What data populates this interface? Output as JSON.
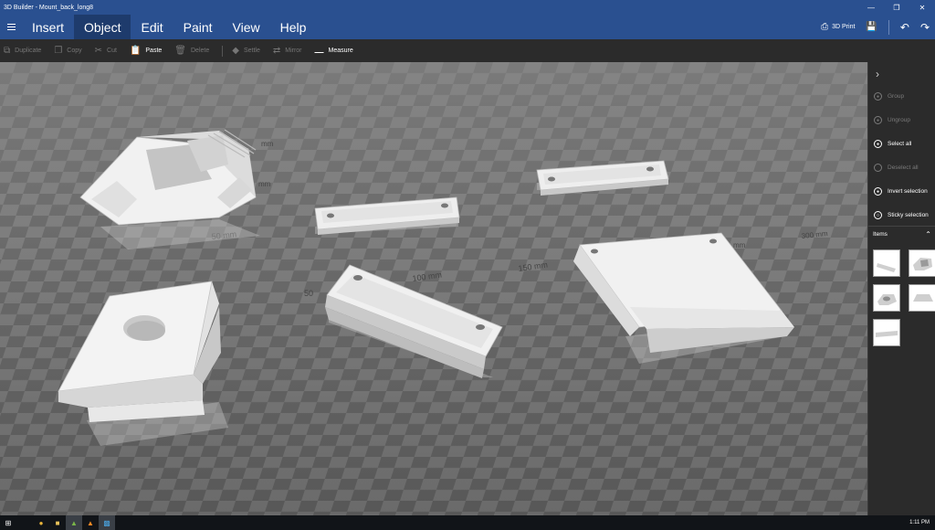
{
  "window": {
    "title": "3D Builder - Mount_back_long8"
  },
  "menu": {
    "items": [
      {
        "label": "Insert"
      },
      {
        "label": "Object"
      },
      {
        "label": "Edit"
      },
      {
        "label": "Paint"
      },
      {
        "label": "View"
      },
      {
        "label": "Help"
      }
    ],
    "active": "Object",
    "print_label": "3D Print"
  },
  "toolbar": {
    "duplicate": "Duplicate",
    "copy": "Copy",
    "cut": "Cut",
    "paste": "Paste",
    "delete": "Delete",
    "settle": "Settle",
    "mirror": "Mirror",
    "measure": "Measure"
  },
  "viewport": {
    "ruler_labels": [
      "50 mm",
      "100 mm",
      "150 mm",
      "50",
      "mm",
      "300 mm",
      "mm",
      "mm"
    ]
  },
  "sidepanel": {
    "group": "Group",
    "ungroup": "Ungroup",
    "select_all": "Select all",
    "deselect_all": "Deselect all",
    "invert_selection": "Invert selection",
    "sticky_selection": "Sticky selection",
    "items_label": "Items"
  },
  "taskbar": {
    "clock": "1:11 PM"
  },
  "colors": {
    "accent": "#2a5090",
    "panel": "#2b2b2b",
    "object": "#e6e6e6"
  }
}
